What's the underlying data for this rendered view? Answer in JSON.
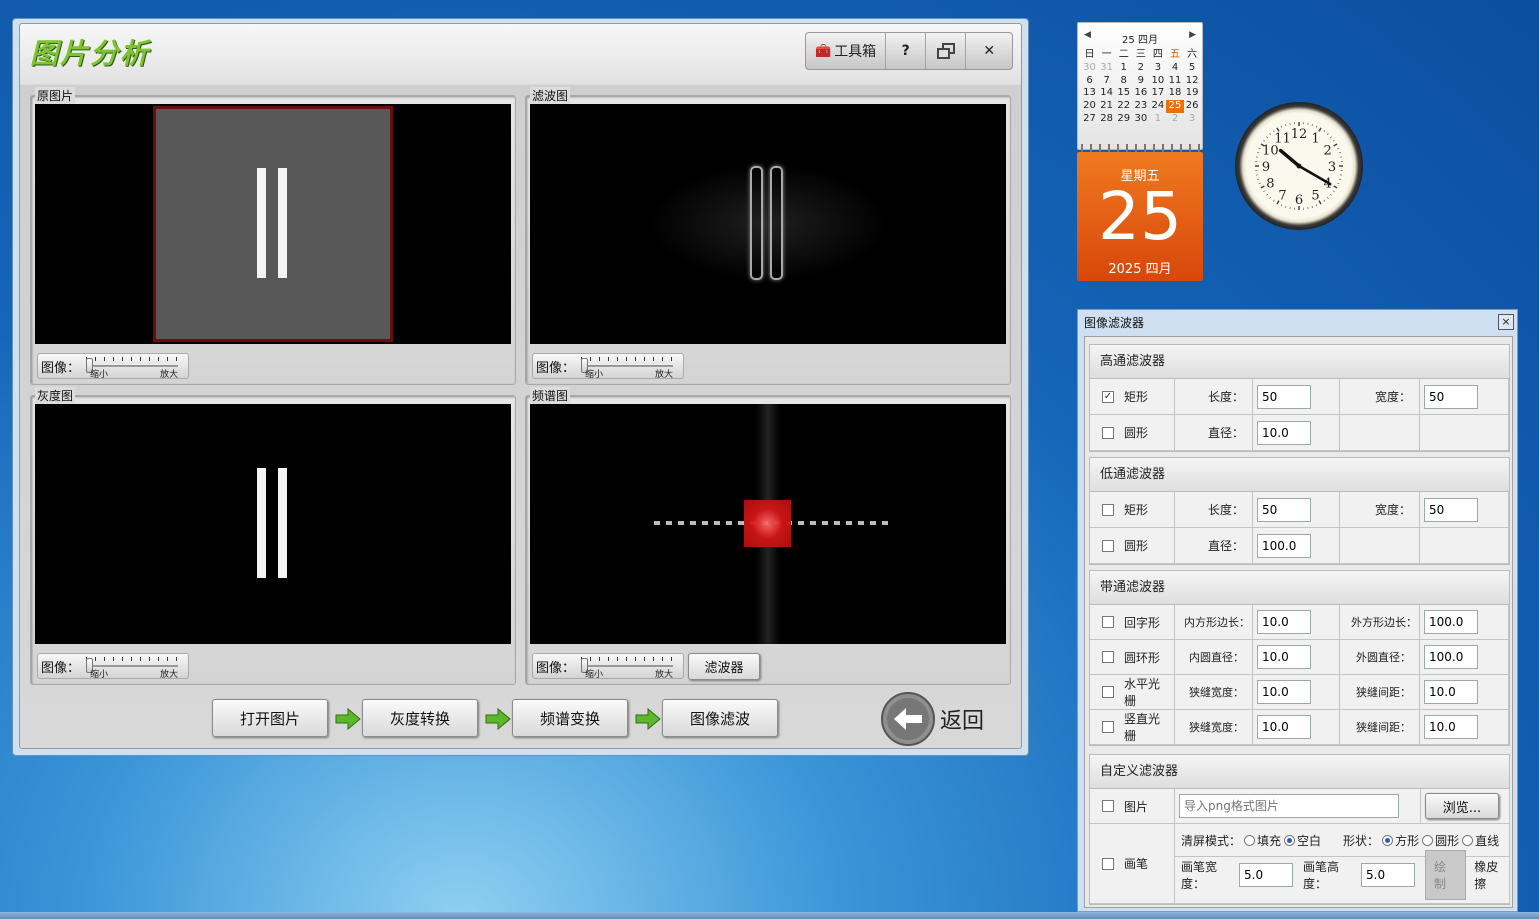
{
  "main_window": {
    "title": "图片分析",
    "toolbar": {
      "toolbox_label": "工具箱",
      "help_label": "?",
      "restore_label": "🗗",
      "close_label": "✕"
    },
    "panels": {
      "original": {
        "label": "原图片"
      },
      "filtered": {
        "label": "滤波图"
      },
      "grayscale": {
        "label": "灰度图"
      },
      "spectrum": {
        "label": "频谱图"
      }
    },
    "slider": {
      "label": "图像：",
      "min_label": "缩小",
      "max_label": "放大",
      "value": 0
    },
    "filter_button": "滤波器",
    "workflow": {
      "step1": "打开图片",
      "step2": "灰度转换",
      "step3": "频谱变换",
      "step4": "图像滤波"
    },
    "back_label": "返回"
  },
  "calendar": {
    "header": "25 四月",
    "weekdays": [
      "日",
      "一",
      "二",
      "三",
      "四",
      "五",
      "六"
    ],
    "weeks": [
      [
        "30",
        "31",
        "1",
        "2",
        "3",
        "4",
        "5"
      ],
      [
        "6",
        "7",
        "8",
        "9",
        "10",
        "11",
        "12"
      ],
      [
        "13",
        "14",
        "15",
        "16",
        "17",
        "18",
        "19"
      ],
      [
        "20",
        "21",
        "22",
        "23",
        "24",
        "25",
        "26"
      ],
      [
        "27",
        "28",
        "29",
        "30",
        "1",
        "2",
        "3"
      ]
    ],
    "today": "25",
    "weekday_name": "星期五",
    "day": "25",
    "year_month": "2025 四月"
  },
  "clock": {
    "numerals": [
      "12",
      "1",
      "2",
      "3",
      "4",
      "5",
      "6",
      "7",
      "8",
      "9",
      "10",
      "11"
    ],
    "time": {
      "hour": 10,
      "minute": 20
    }
  },
  "filter_window": {
    "title": "图像滤波器",
    "close": "×",
    "highpass": {
      "title": "高通滤波器",
      "rect": {
        "label": "矩形",
        "checked": "✓",
        "length_label": "长度：",
        "length": "50",
        "width_label": "宽度：",
        "width": "50"
      },
      "circle": {
        "label": "圆形",
        "diameter_label": "直径：",
        "diameter": "10.0"
      }
    },
    "lowpass": {
      "title": "低通滤波器",
      "rect": {
        "label": "矩形",
        "length_label": "长度：",
        "length": "50",
        "width_label": "宽度：",
        "width": "50"
      },
      "circle": {
        "label": "圆形",
        "diameter_label": "直径：",
        "diameter": "100.0"
      }
    },
    "bandpass": {
      "title": "带通滤波器",
      "square_ring": {
        "label": "回字形",
        "inner_label": "内方形边长：",
        "inner": "10.0",
        "outer_label": "外方形边长：",
        "outer": "100.0"
      },
      "circle_ring": {
        "label": "圆环形",
        "inner_label": "内圆直径：",
        "inner": "10.0",
        "outer_label": "外圆直径：",
        "outer": "100.0"
      },
      "h_grating": {
        "label": "水平光栅",
        "slit_label": "狭缝宽度：",
        "slit": "10.0",
        "gap_label": "狭缝间距：",
        "gap": "10.0"
      },
      "v_grating": {
        "label": "竖直光栅",
        "slit_label": "狭缝宽度：",
        "slit": "10.0",
        "gap_label": "狭缝间距：",
        "gap": "10.0"
      }
    },
    "custom": {
      "title": "自定义滤波器",
      "image": {
        "label": "图片",
        "placeholder": "导入png格式图片",
        "browse": "浏览..."
      },
      "brush": {
        "label": "画笔",
        "clear_mode_label": "清屏模式：",
        "fill_label": "填充",
        "blank_label": "空白",
        "shape_label": "形状：",
        "square_label": "方形",
        "round_label": "圆形",
        "line_label": "直线",
        "brush_width_label": "画笔宽度：",
        "brush_width": "5.0",
        "brush_height_label": "画笔高度：",
        "brush_height": "5.0",
        "draw_label": "绘制",
        "eraser_label": "橡皮擦"
      }
    }
  }
}
